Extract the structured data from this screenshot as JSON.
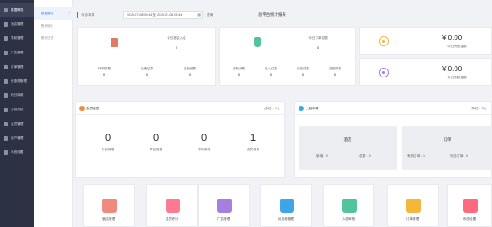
{
  "sidebar": {
    "items": [
      {
        "label": "数据概况",
        "active": true
      },
      {
        "label": "酒店管理"
      },
      {
        "label": "导航管理"
      },
      {
        "label": "广告管理"
      },
      {
        "label": "订单管理"
      },
      {
        "label": "优惠券管理"
      },
      {
        "label": "积分商城"
      },
      {
        "label": "分销系统"
      },
      {
        "label": "会员管理"
      },
      {
        "label": "用户管理"
      },
      {
        "label": "系统设置"
      }
    ]
  },
  "subnav": {
    "items": [
      {
        "label": "数据展示",
        "active": true
      },
      {
        "label": "账号统计"
      },
      {
        "label": "账号日志"
      }
    ]
  },
  "filter": {
    "label": "今日/本周",
    "date_range": "2019-07-08 09:44 至 2019-07-08 09:44",
    "query_button": "查询",
    "report_title": "总平台统计报表"
  },
  "stats": {
    "checkin": {
      "title": "今日酒店入住",
      "value": "0",
      "sub": [
        {
          "label": "待审核数",
          "value": "0"
        },
        {
          "label": "已通过数",
          "value": "0"
        },
        {
          "label": "已拒绝数",
          "value": "0"
        }
      ]
    },
    "sales": {
      "title": "今日订单总额",
      "value": "0",
      "sub": [
        {
          "label": "已取消数",
          "value": "0"
        },
        {
          "label": "已入住数",
          "value": "0"
        },
        {
          "label": "已完成数",
          "value": "0"
        },
        {
          "label": "已退款数",
          "value": "0"
        }
      ]
    },
    "money": [
      {
        "amount": "¥ 0.00",
        "label": "今日销售金额"
      },
      {
        "amount": "¥ 0.00",
        "label": "今日退款金额"
      }
    ]
  },
  "members": {
    "title": "会员信息",
    "unit": "(单位：人)",
    "items": [
      {
        "value": "0",
        "label": "今日新增"
      },
      {
        "value": "0",
        "label": "昨日新增"
      },
      {
        "value": "0",
        "label": "本月新增"
      },
      {
        "value": "1",
        "label": "会员总数"
      }
    ]
  },
  "checkin_apply": {
    "title": "入驻申请",
    "unit": "(单位：个)",
    "hotel": {
      "title": "酒店",
      "new_label": "新增：0",
      "total_label": "总数：0"
    },
    "orders": {
      "title": "订单",
      "active_label": "有效订单：1",
      "completed_label": "完成订单：0"
    }
  },
  "tiles": [
    {
      "label": "酒店管理",
      "icon": "hotel-icon",
      "color": "#f08a7e"
    },
    {
      "label": "会员积分",
      "icon": "points-icon",
      "color": "#ff7a91"
    },
    {
      "label": "广告管理",
      "icon": "ad-icon",
      "color": "#a57fe0"
    },
    {
      "label": "优惠券管理",
      "icon": "coupon-icon",
      "color": "#3ea6e8"
    },
    {
      "label": "入驻审核",
      "icon": "audit-icon",
      "color": "#52c49b"
    },
    {
      "label": "订单管理",
      "icon": "order-icon",
      "color": "#f5b73b"
    },
    {
      "label": "系统设置",
      "icon": "settings-icon",
      "color": "#ff6a7f"
    }
  ],
  "colors": {
    "sidebar_bg": "#2c3144",
    "accent": "#3a7bd5",
    "money_yellow": "#f5b73b",
    "money_purple": "#a57fe0",
    "members_orange": "#f08a3c",
    "apply_blue": "#3ea6e8"
  }
}
